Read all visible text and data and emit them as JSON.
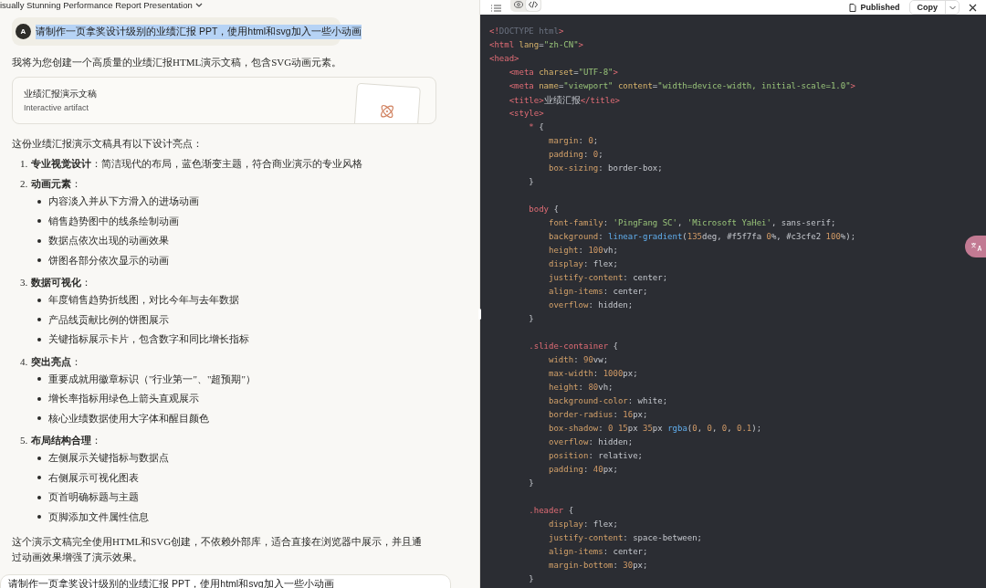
{
  "header": {
    "title": "isually Stunning Performance Report Presentation"
  },
  "user_message": {
    "avatar": "A",
    "text": "请制作一页拿奖设计级别的业绩汇报 PPT，使用html和svg加入一些小动画",
    "highlighted": true
  },
  "reply": {
    "intro": "我将为您创建一个高质量的业绩汇报HTML演示文稿，包含SVG动画元素。",
    "artifact": {
      "title": "业绩汇报演示文稿",
      "subtitle": "Interactive artifact"
    },
    "lead": "这份业绩汇报演示文稿具有以下设计亮点：",
    "points": [
      {
        "number": "1.",
        "text": "**专业视觉设计**：简洁现代的布局，蓝色渐变主题，符合商业演示的专业风格"
      },
      {
        "number": "2.",
        "text": "**动画元素**：",
        "bullets": [
          "内容淡入并从下方滑入的进场动画",
          "销售趋势图中的线条绘制动画",
          "数据点依次出现的动画效果",
          "饼图各部分依次显示的动画"
        ]
      },
      {
        "number": "3.",
        "text": "**数据可视化**：",
        "bullets": [
          "年度销售趋势折线图，对比今年与去年数据",
          "产品线贡献比例的饼图展示",
          "关键指标展示卡片，包含数字和同比增长指标"
        ]
      },
      {
        "number": "4.",
        "text": "**突出亮点**：",
        "bullets": [
          "重要成就用徽章标识（\"行业第一\"、\"超预期\"）",
          "增长率指标用绿色上箭头直观展示",
          "核心业绩数据使用大字体和醒目颜色"
        ]
      },
      {
        "number": "5.",
        "text": "**布局结构合理**：",
        "bullets": [
          "左侧展示关键指标与数据点",
          "右侧展示可视化图表",
          "页首明确标题与主题",
          "页脚添加文件属性信息"
        ]
      }
    ],
    "closing": "这个演示文稿完全使用HTML和SVG创建，不依赖外部库，适合直接在浏览器中展示，并且通过动画效果增强了演示效果。"
  },
  "composer": {
    "value": "请制作一页拿奖设计级别的业绩汇报 PPT，使用html和svg加入一些小动画"
  },
  "artifact_panel": {
    "view_tabs": [
      {
        "kind": "preview",
        "selected": false
      },
      {
        "kind": "code",
        "selected": true
      }
    ],
    "status": "Published",
    "copy_button": "Copy",
    "code_lines": [
      "<!DOCTYPE html>",
      "<html lang=\"zh-CN\">",
      "<head>",
      "    <meta charset=\"UTF-8\">",
      "    <meta name=\"viewport\" content=\"width=device-width, initial-scale=1.0\">",
      "    <title>业绩汇报</title>",
      "    <style>",
      "        * {",
      "            margin: 0;",
      "            padding: 0;",
      "            box-sizing: border-box;",
      "        }",
      "        body {",
      "            font-family: 'PingFang SC', 'Microsoft YaHei', sans-serif;",
      "            background: linear-gradient(135deg, #f5f7fa 0%, #c3cfe2 100%);",
      "            height: 100vh;",
      "            display: flex;",
      "            justify-content: center;",
      "            align-items: center;",
      "            overflow: hidden;",
      "        }",
      "        .slide-container {",
      "            width: 90vw;",
      "            max-width: 1000px;",
      "            height: 80vh;",
      "            background-color: white;",
      "            border-radius: 16px;",
      "            box-shadow: 0 15px 35px rgba(0, 0, 0, 0.1);",
      "            overflow: hidden;",
      "            position: relative;",
      "            padding: 40px;",
      "        }",
      "        .header {",
      "            display: flex;",
      "            justify-content: space-between;",
      "            align-items: center;",
      "            margin-bottom: 30px;",
      "        }"
    ]
  }
}
